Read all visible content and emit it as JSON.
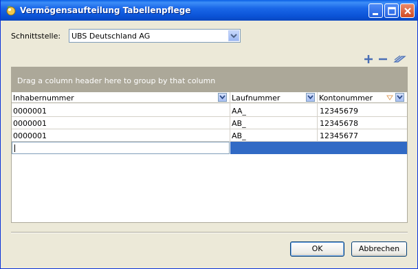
{
  "window": {
    "title": "Vermögensaufteilung Tabellenpflege"
  },
  "interface": {
    "label": "Schnittstelle:",
    "selected": "UBS Deutschland AG"
  },
  "toolbar": {
    "icons": [
      "plus-icon",
      "minus-icon",
      "eraser-icon"
    ]
  },
  "grid": {
    "group_hint": "Drag a column header here to group by that column",
    "columns": [
      "Inhabernummer",
      "Laufnummer",
      "Kontonummer"
    ],
    "rows": [
      [
        "0000001",
        "AA_",
        "12345679"
      ],
      [
        "0000001",
        "AB_",
        "12345678"
      ],
      [
        "0000001",
        "AB_",
        "12345677"
      ]
    ]
  },
  "buttons": {
    "ok": "OK",
    "cancel": "Abbrechen"
  },
  "colors": {
    "titlebar": "#0a52d6",
    "selection": "#316ac5",
    "group_area": "#aca899",
    "window_bg": "#ece9d8"
  }
}
